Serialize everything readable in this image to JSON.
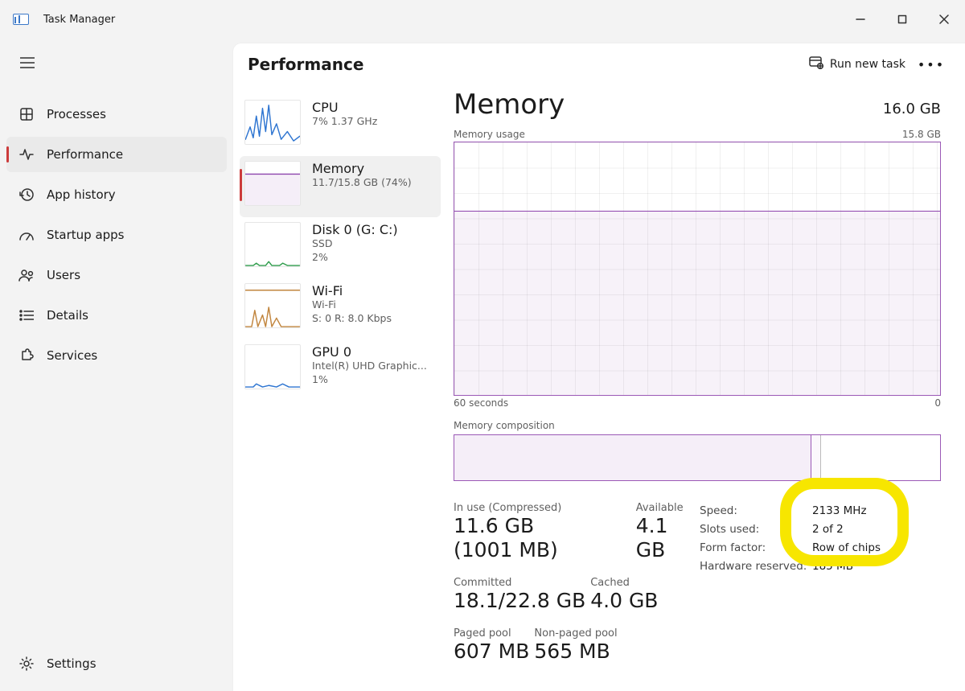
{
  "app": {
    "title": "Task Manager"
  },
  "sidebar": {
    "items": [
      {
        "label": "Processes"
      },
      {
        "label": "Performance"
      },
      {
        "label": "App history"
      },
      {
        "label": "Startup apps"
      },
      {
        "label": "Users"
      },
      {
        "label": "Details"
      },
      {
        "label": "Services"
      }
    ],
    "settings_label": "Settings"
  },
  "header": {
    "title": "Performance",
    "run_new_task": "Run new task"
  },
  "perf_list": {
    "cpu": {
      "title": "CPU",
      "l1": "7%  1.37 GHz"
    },
    "mem": {
      "title": "Memory",
      "l1": "11.7/15.8 GB (74%)"
    },
    "disk": {
      "title": "Disk 0 (G: C:)",
      "l1": "SSD",
      "l2": "2%"
    },
    "wifi": {
      "title": "Wi-Fi",
      "l1": "Wi-Fi",
      "l2": "S: 0 R: 8.0 Kbps"
    },
    "gpu": {
      "title": "GPU 0",
      "l1": "Intel(R) UHD Graphic...",
      "l2": "1%"
    }
  },
  "detail": {
    "title": "Memory",
    "capacity": "16.0 GB",
    "usage_label": "Memory usage",
    "usage_max": "15.8 GB",
    "xaxis_left": "60 seconds",
    "xaxis_right": "0",
    "comp_label": "Memory composition",
    "stats": {
      "inuse_label": "In use (Compressed)",
      "inuse_value": "11.6 GB (1001 MB)",
      "available_label": "Available",
      "available_value": "4.1 GB",
      "committed_label": "Committed",
      "committed_value": "18.1/22.8 GB",
      "cached_label": "Cached",
      "cached_value": "4.0 GB",
      "paged_label": "Paged pool",
      "paged_value": "607 MB",
      "nonpaged_label": "Non-paged pool",
      "nonpaged_value": "565 MB"
    },
    "kv": {
      "speed_k": "Speed:",
      "speed_v": "2133 MHz",
      "slots_k": "Slots used:",
      "slots_v": "2 of 2",
      "form_k": "Form factor:",
      "form_v": "Row of chips",
      "hw_k": "Hardware reserved:",
      "hw_v": "185 MB"
    }
  },
  "chart_data": {
    "type": "area",
    "title": "Memory usage",
    "xlabel": "seconds ago",
    "ylabel": "GB",
    "x_range": [
      60,
      0
    ],
    "ylim": [
      0,
      15.8
    ],
    "series": [
      {
        "name": "In use",
        "x": [
          60,
          55,
          50,
          45,
          40,
          35,
          30,
          25,
          20,
          15,
          10,
          5,
          0
        ],
        "values": [
          11.6,
          11.6,
          11.6,
          11.6,
          11.6,
          11.6,
          11.6,
          11.6,
          11.5,
          11.6,
          11.6,
          11.6,
          11.6
        ]
      }
    ],
    "composition_bar": {
      "total_gb": 15.8,
      "segments": [
        {
          "name": "In use",
          "gb": 11.6
        },
        {
          "name": "Modified",
          "gb": 0.3
        },
        {
          "name": "Standby/Free",
          "gb": 3.9
        }
      ]
    }
  }
}
